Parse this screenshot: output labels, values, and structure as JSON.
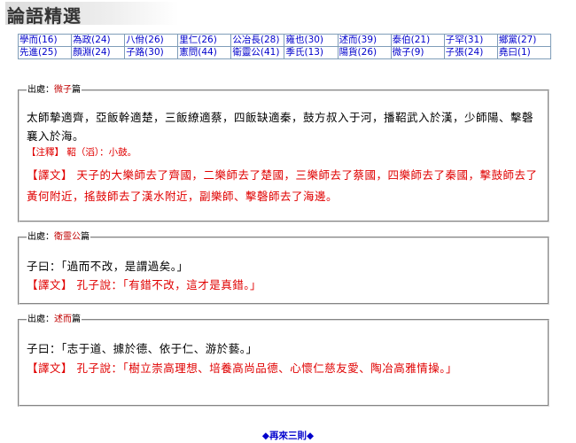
{
  "page_title": "論語精選",
  "nav": {
    "rows": [
      [
        "學而(16)",
        "為政(24)",
        "八佾(26)",
        "里仁(26)",
        "公冶長(28)",
        "雍也(30)",
        "述而(39)",
        "泰伯(21)",
        "子罕(31)",
        "鄉黨(27)"
      ],
      [
        "先進(25)",
        "顏淵(24)",
        "子路(30)",
        "憲問(44)",
        "衛靈公(41)",
        "季氏(13)",
        "陽貨(26)",
        "微子(9)",
        "子張(24)",
        "堯曰(1)"
      ]
    ]
  },
  "source_label": "出處：",
  "chapter_suffix": "篇",
  "passages": [
    {
      "chapter": "微子",
      "text": "太師摯適齊，亞飯幹適楚，三飯繚適蔡，四飯缺適秦，鼓方叔入于河，播鞀武入於漢，少師陽、擊磬襄入於海。",
      "note": "【注釋】 鞀（滔）：小鼓。",
      "translation": "【譯文】 天子的大樂師去了齊國，二樂師去了楚國，三樂師去了蔡國，四樂師去了秦國，擊鼓師去了黃何附近，搖鼓師去了漢水附近，副樂師、擊磬師去了海邊。"
    },
    {
      "chapter": "衛靈公",
      "text": "子曰：「過而不改，是謂過矣。」",
      "translation": "【譯文】 孔子說：「有錯不改，這才是真錯。」"
    },
    {
      "chapter": "述而",
      "text": "子曰：「志于道、據於德、依于仁、游於藝。」",
      "translation": "【譯文】 孔子說：「樹立崇高理想、培養高尚品德、心懷仁慈友愛、陶冶高雅情操。」"
    }
  ],
  "more_link": "◆再來三則◆"
}
